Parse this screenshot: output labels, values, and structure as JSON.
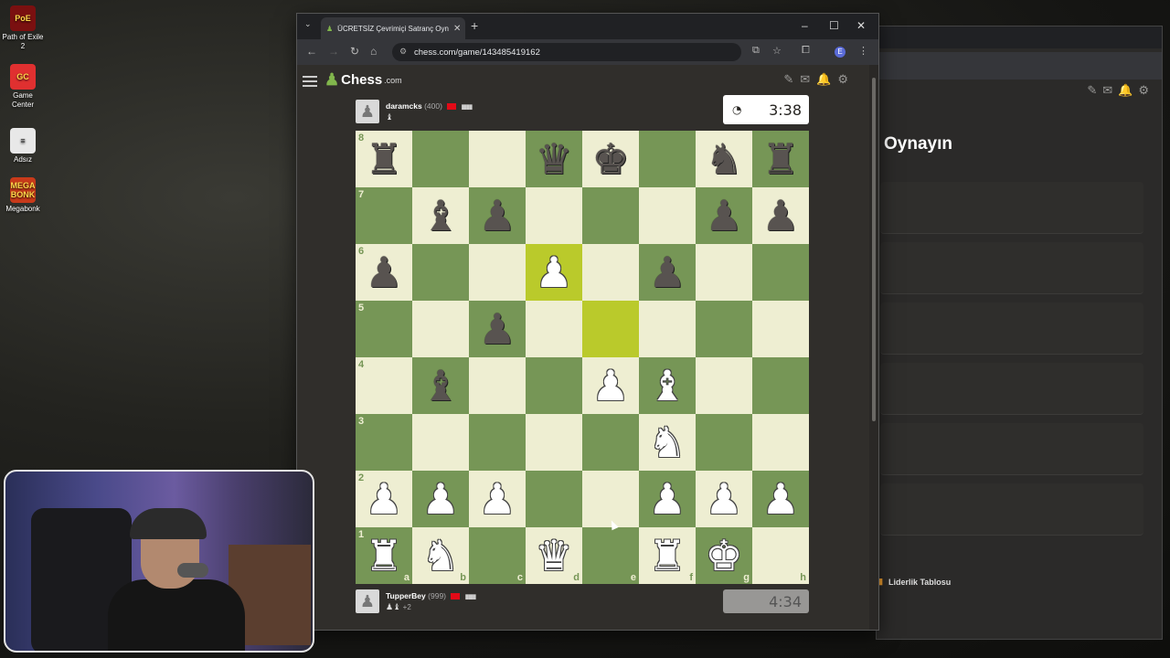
{
  "desktop": {
    "icons": [
      {
        "label": "Path of Exile 2",
        "glyph": "PoE"
      },
      {
        "label": "Game Center",
        "glyph": "GC"
      },
      {
        "label": "Adsız",
        "glyph": "≡"
      },
      {
        "label": "Megabonk",
        "glyph": "MEGA BONK"
      }
    ]
  },
  "back_window": {
    "heading": "Oynayın",
    "leaderboard_label": "Liderlik Tablosu"
  },
  "browser": {
    "tab_title": "ÜCRETSİZ Çevrimiçi Satranç Oyn",
    "url": "chess.com/game/143485419162",
    "profile_initial": "E"
  },
  "site": {
    "logo_text": "Chess",
    "logo_suffix": ".com"
  },
  "top_player": {
    "name": "daramcks",
    "rating": "(400)",
    "clock": "3:38",
    "captured": "♝",
    "clock_active": true
  },
  "bottom_player": {
    "name": "TupperBey",
    "rating": "(999)",
    "clock": "4:34",
    "captured": "♟♝",
    "advantage": "+2",
    "clock_active": false
  },
  "board": {
    "files": [
      "a",
      "b",
      "c",
      "d",
      "e",
      "f",
      "g",
      "h"
    ],
    "ranks": [
      "8",
      "7",
      "6",
      "5",
      "4",
      "3",
      "2",
      "1"
    ],
    "position": [
      [
        "bR",
        "",
        "",
        "bQ",
        "bK",
        "",
        "bN",
        "bR"
      ],
      [
        "",
        "bB",
        "bP",
        "",
        "",
        "",
        "bP",
        "bP"
      ],
      [
        "bP",
        "",
        "",
        "wP",
        "",
        "bP",
        "",
        ""
      ],
      [
        "",
        "",
        "bP",
        "",
        "",
        "",
        "",
        ""
      ],
      [
        "",
        "bB",
        "",
        "",
        "wP",
        "wB",
        "",
        ""
      ],
      [
        "",
        "",
        "",
        "",
        "",
        "wN",
        "",
        ""
      ],
      [
        "wP",
        "wP",
        "wP",
        "",
        "",
        "wP",
        "wP",
        "wP"
      ],
      [
        "wR",
        "wN",
        "",
        "wQ",
        "",
        "wR",
        "wK",
        ""
      ]
    ],
    "highlighted": [
      "d6",
      "e5"
    ],
    "colors": {
      "light": "#eeeed2",
      "dark": "#769656",
      "highlight_light": "#f6f669",
      "highlight_dark": "#baca2b"
    }
  },
  "colors": {
    "brand": "#81b64c",
    "background": "#302e2b"
  }
}
